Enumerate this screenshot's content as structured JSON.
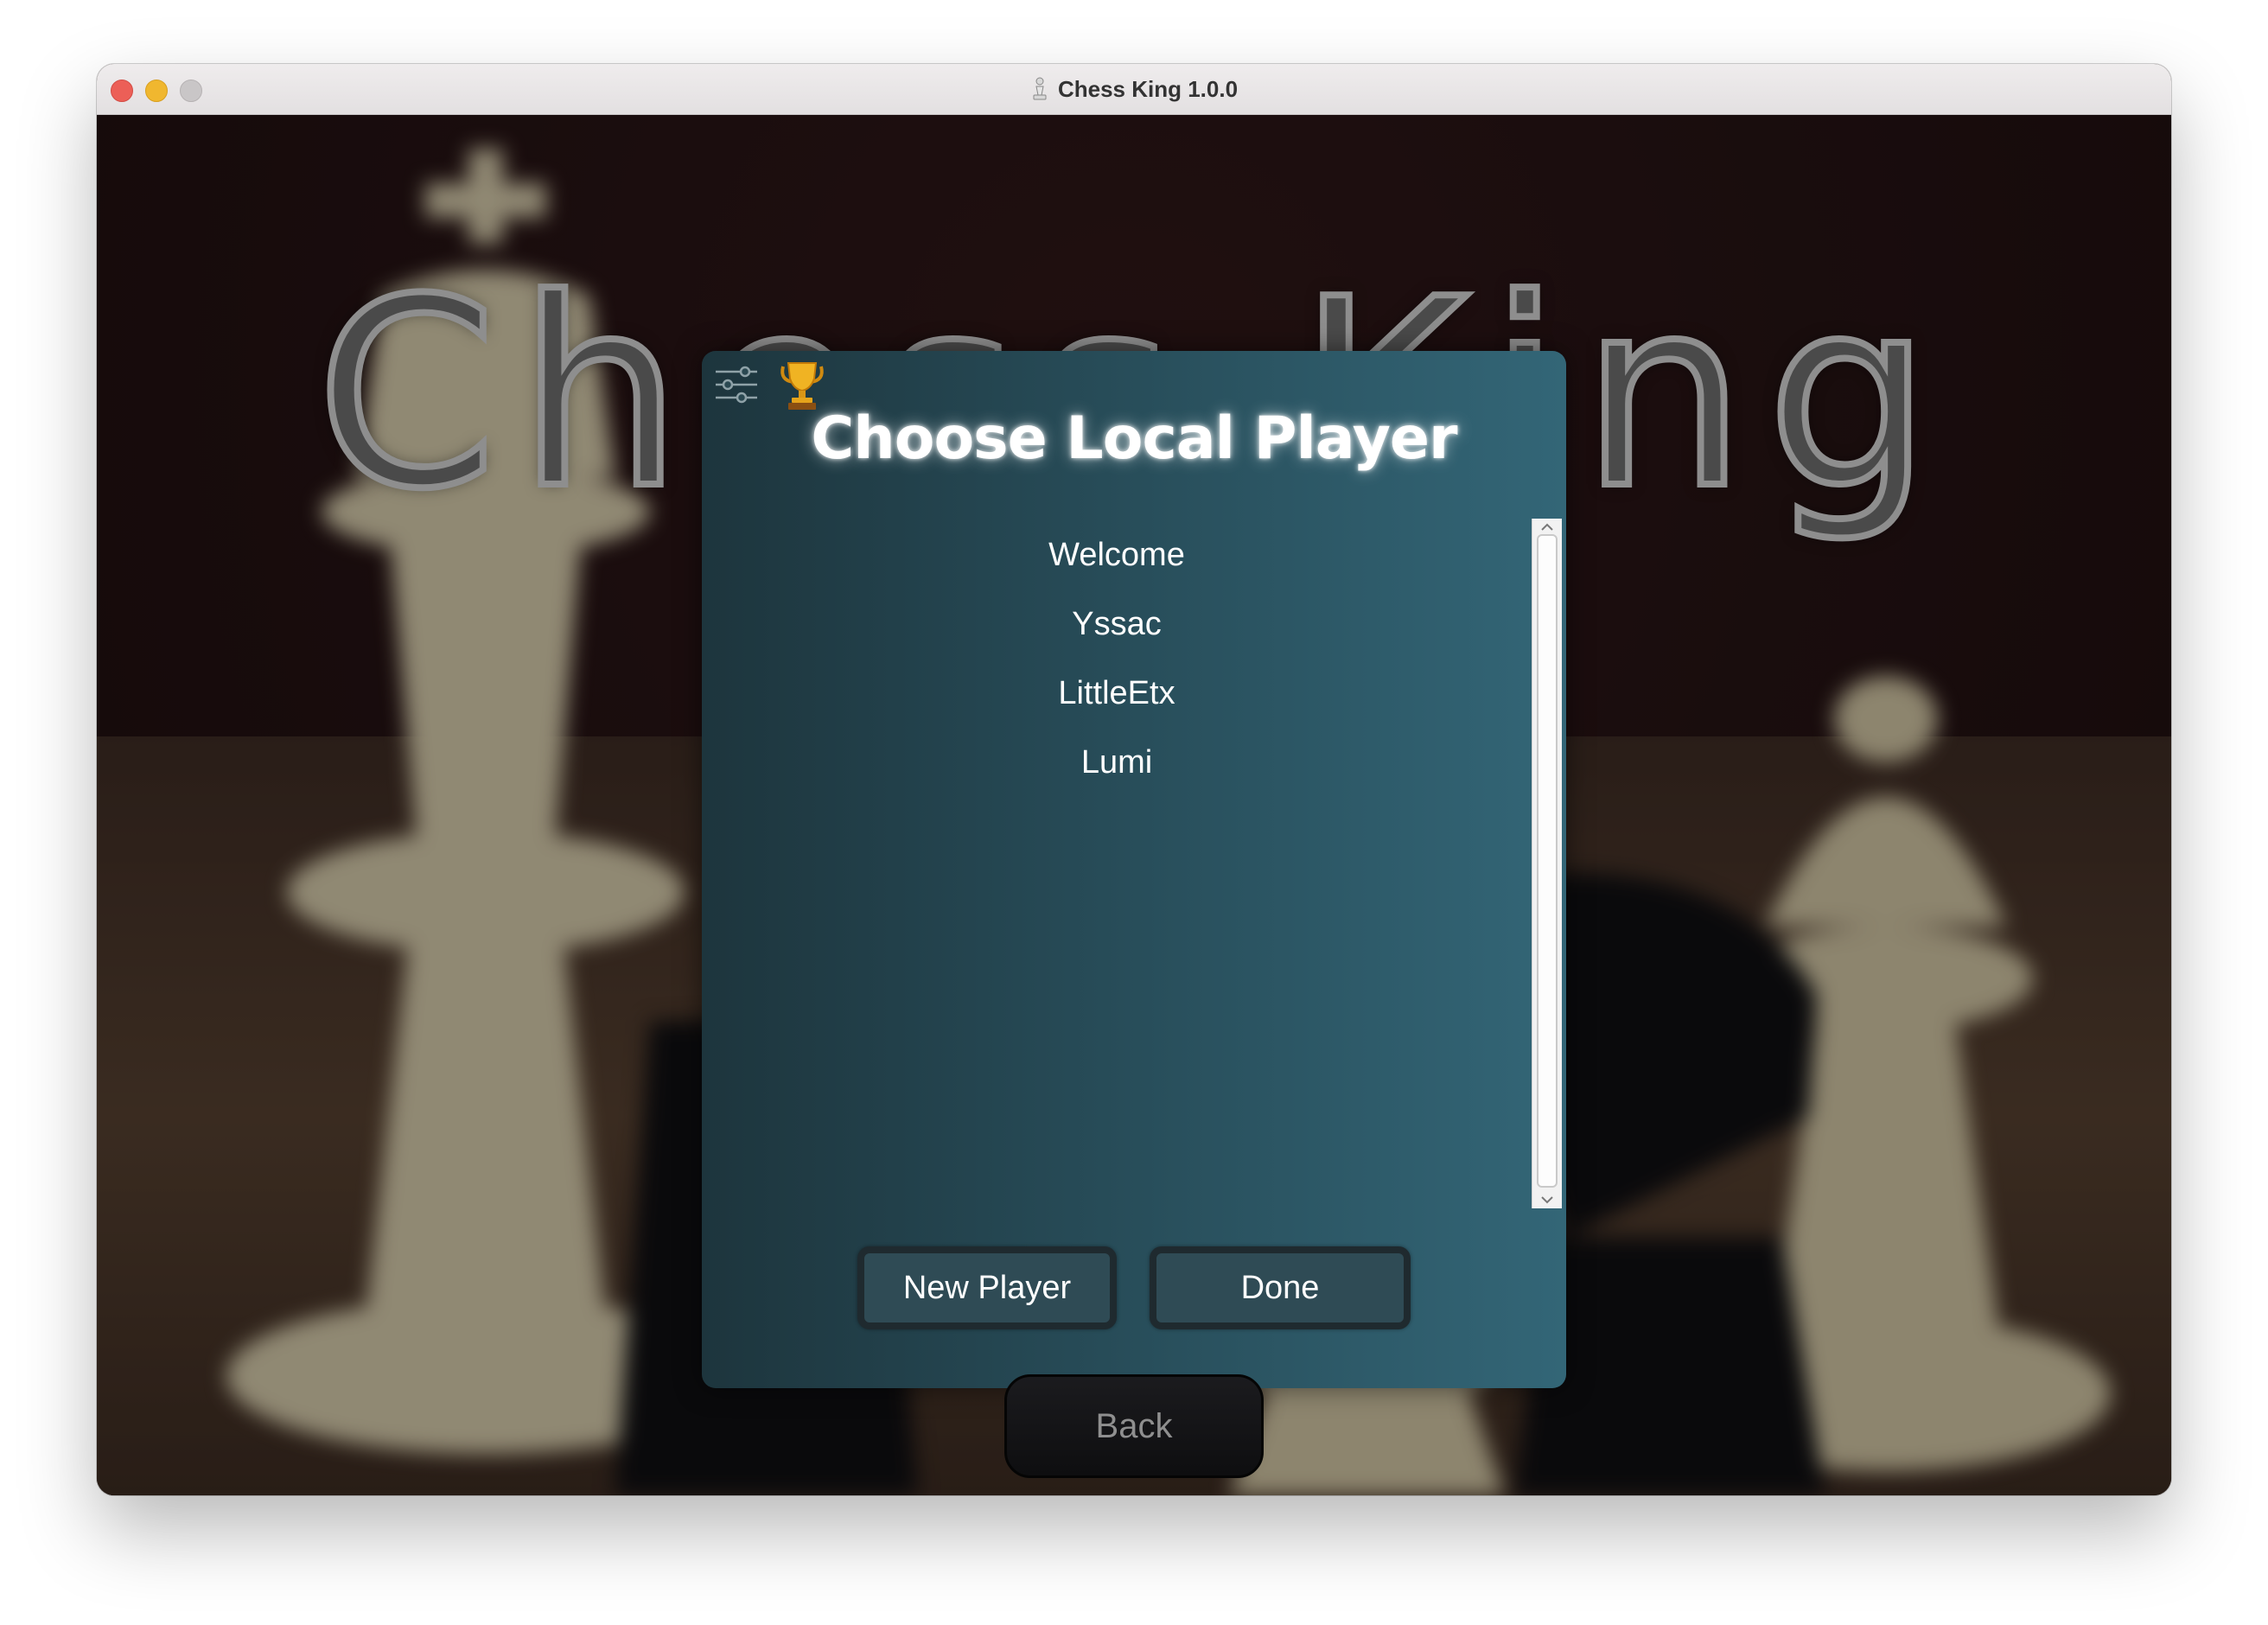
{
  "window": {
    "title": "Chess King 1.0.0",
    "traffic_lights": {
      "close": "#ec5f57",
      "minimize": "#f0b72f",
      "maximize": "#c9c6c7"
    }
  },
  "background": {
    "title_text": "Chess King"
  },
  "dialog": {
    "title": "Choose Local Player",
    "icons": {
      "settings": "sliders-icon",
      "trophy": "trophy-icon"
    },
    "players": [
      "Welcome",
      "Yssac",
      "LittleEtx",
      "Lumi"
    ],
    "new_player_label": "New Player",
    "done_label": "Done"
  },
  "back_label": "Back",
  "colors": {
    "dialog_gradient_start": "#1d353d",
    "dialog_gradient_end": "#336677",
    "button_fill": "#2f4b55",
    "button_border": "#1f2a2f"
  }
}
